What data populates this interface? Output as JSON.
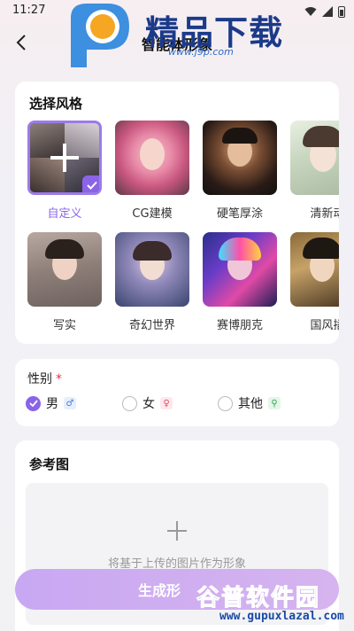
{
  "status_bar": {
    "time": "11:27"
  },
  "header": {
    "title": "智能体形象"
  },
  "watermark_top": {
    "text": "精品下载",
    "url": "www.j9p.com"
  },
  "style_section": {
    "title": "选择风格",
    "items": [
      {
        "label": "自定义",
        "selected": true
      },
      {
        "label": "CG建模",
        "selected": false
      },
      {
        "label": "硬笔厚涂",
        "selected": false
      },
      {
        "label": "清新动",
        "selected": false
      },
      {
        "label": "写实",
        "selected": false
      },
      {
        "label": "奇幻世界",
        "selected": false
      },
      {
        "label": "赛博朋克",
        "selected": false
      },
      {
        "label": "国风插",
        "selected": false
      }
    ]
  },
  "gender_section": {
    "title": "性别",
    "required_mark": "*",
    "options": [
      {
        "label": "男",
        "symbol": "♂",
        "checked": true
      },
      {
        "label": "女",
        "symbol": "♀",
        "checked": false
      },
      {
        "label": "其他",
        "symbol": "⚲",
        "checked": false
      }
    ]
  },
  "reference_section": {
    "title": "参考图",
    "upload_hint": "将基于上传的图片作为形象"
  },
  "generate_button": {
    "label": "生成形"
  },
  "watermark_bottom": {
    "text": "谷普软件园",
    "url": "www.gupuxlazal.com"
  },
  "colors": {
    "accent": "#8a64e6",
    "button": "#cfaef1",
    "required": "#e0334a"
  }
}
